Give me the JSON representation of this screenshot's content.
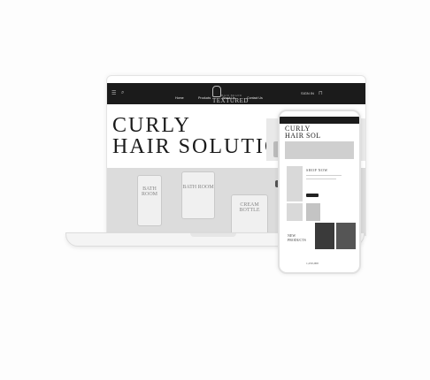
{
  "site": {
    "logo": "TEXTURED",
    "logo_sub": "HAIR BRAND",
    "nav": [
      "Home",
      "Products",
      "About Us",
      "Contact Us"
    ],
    "header_right": "SIGN IN",
    "hero_title_line1": "CURLY",
    "hero_title_line2": "HAIR SOLUTION",
    "jar1": "BATH ROOM",
    "jar2": "BATH ROOM",
    "jar3": "CREAM BOTTLE"
  },
  "phone": {
    "title_line1": "CURLY",
    "title_line2": "HAIR SOL",
    "section": "SHOP NOW",
    "section2": "NEW PRODUCTS",
    "footer": "1,250,000"
  },
  "colors": {
    "header_bg": "#1b1b1b",
    "accent": "#222222"
  }
}
